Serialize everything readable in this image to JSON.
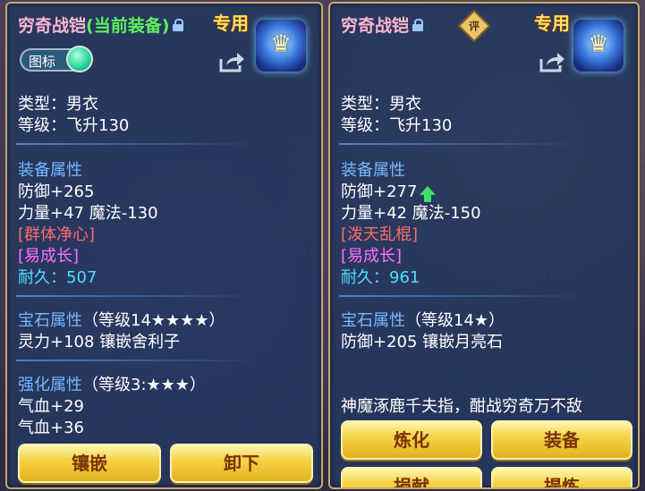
{
  "left_panel": {
    "title": "穷奇战铠",
    "equipped_tag": "(当前装备)",
    "special": "专用",
    "toggle_label": "图标",
    "type": "类型：男衣",
    "level": "等级：飞升130",
    "attr_header": "装备属性",
    "defense": "防御+265",
    "str_magic": "力量+47 魔法-130",
    "skill": "[群体净心]",
    "effect": "[易成长]",
    "durability_label": "耐久：",
    "durability_value": "507",
    "gem_header": "宝石属性",
    "gem_level": "（等级14★★★★）",
    "gem_line": "灵力+108 镶嵌舍利子",
    "enhance_header": "强化属性",
    "enhance_level": "（等级3:★★★）",
    "enhance_line1": "气血+29",
    "enhance_line2": "气血+36",
    "btn_inlay": "镶嵌",
    "btn_unequip": "卸下"
  },
  "right_panel": {
    "title": "穷奇战铠",
    "rate_badge": "评",
    "special": "专用",
    "type": "类型：男衣",
    "level": "等级：飞升130",
    "attr_header": "装备属性",
    "defense": "防御+277",
    "str_magic": "力量+42 魔法-150",
    "skill": "[泼天乱棍]",
    "effect": "[易成长]",
    "durability_label": "耐久：",
    "durability_value": "961",
    "gem_header": "宝石属性",
    "gem_level": "（等级14★）",
    "gem_line": "防御+205 镶嵌月亮石",
    "flavor": "神魔涿鹿千夫指，酣战穷奇万不敌",
    "btn_refine": "炼化",
    "btn_equip": "装备",
    "btn_donate": "捐献",
    "btn_extract": "提炼"
  },
  "colors": {
    "title": "#ffb6d0",
    "equipped": "#5cf25c",
    "header": "#77b8ff",
    "skill": "#ff6b6b",
    "effect": "#ff70ff",
    "durability": "#4ae0ff",
    "button_text": "#7a3200"
  }
}
